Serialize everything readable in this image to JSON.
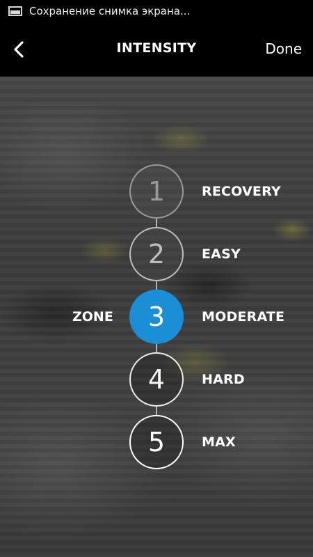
{
  "status_bar": {
    "text": "Сохранение снимка экрана...",
    "icon": "screenshot-icon"
  },
  "header": {
    "title": "INTENSITY",
    "back_icon": "chevron-left-icon",
    "done_label": "Done"
  },
  "zone_selector": {
    "side_label": "ZONE",
    "selected_zone": 3,
    "accent_color": "#1b8fd6",
    "zones": [
      {
        "number": "1",
        "label": "RECOVERY"
      },
      {
        "number": "2",
        "label": "EASY"
      },
      {
        "number": "3",
        "label": "MODERATE"
      },
      {
        "number": "4",
        "label": "HARD"
      },
      {
        "number": "5",
        "label": "MAX"
      }
    ]
  }
}
